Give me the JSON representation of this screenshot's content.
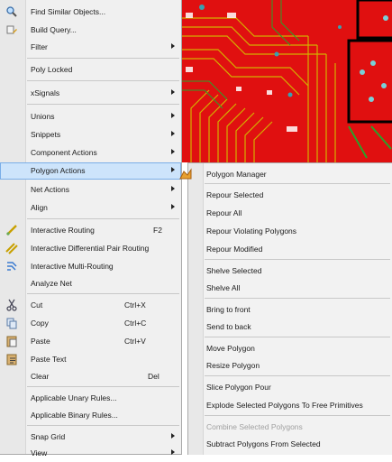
{
  "main_menu": {
    "items": [
      {
        "label": "Find Similar Objects...",
        "icon": "find-similar-icon"
      },
      {
        "label": "Build Query...",
        "icon": "build-query-icon"
      },
      {
        "label": "Filter"
      },
      {
        "label": "Poly Locked"
      },
      {
        "label": "xSignals"
      },
      {
        "label": "Unions"
      },
      {
        "label": "Snippets"
      },
      {
        "label": "Component Actions"
      },
      {
        "label": "Polygon Actions"
      },
      {
        "label": "Net Actions"
      },
      {
        "label": "Align"
      },
      {
        "label": "Interactive Routing",
        "shortcut": "F2",
        "icon": "interactive-routing-icon"
      },
      {
        "label": "Interactive Differential Pair Routing",
        "icon": "diff-pair-routing-icon"
      },
      {
        "label": "Interactive Multi-Routing",
        "icon": "multi-routing-icon"
      },
      {
        "label": "Analyze Net"
      },
      {
        "label": "Cut",
        "shortcut": "Ctrl+X",
        "icon": "cut-icon"
      },
      {
        "label": "Copy",
        "shortcut": "Ctrl+C",
        "icon": "copy-icon"
      },
      {
        "label": "Paste",
        "shortcut": "Ctrl+V",
        "icon": "paste-icon"
      },
      {
        "label": "Paste Text",
        "icon": "paste-text-icon"
      },
      {
        "label": "Clear",
        "shortcut": "Del"
      },
      {
        "label": "Applicable Unary Rules..."
      },
      {
        "label": "Applicable Binary Rules..."
      },
      {
        "label": "Snap Grid"
      },
      {
        "label": "View"
      }
    ]
  },
  "sub_menu": {
    "items": [
      {
        "label": "Polygon Manager",
        "icon": "polygon-manager-icon"
      },
      {
        "label": "Repour Selected"
      },
      {
        "label": "Repour All"
      },
      {
        "label": "Repour Violating Polygons"
      },
      {
        "label": "Repour Modified"
      },
      {
        "label": "Shelve Selected"
      },
      {
        "label": "Shelve All"
      },
      {
        "label": "Bring to front"
      },
      {
        "label": "Send to back"
      },
      {
        "label": "Move Polygon"
      },
      {
        "label": "Resize Polygon"
      },
      {
        "label": "Slice Polygon Pour"
      },
      {
        "label": "Explode Selected Polygons To Free Primitives"
      },
      {
        "label": "Combine Selected Polygons"
      },
      {
        "label": "Subtract Polygons From Selected"
      }
    ]
  },
  "colors": {
    "pcb_background": "#e01010",
    "pcb_trace": "#d4b000",
    "highlight": "#cde4fb",
    "disabled_text": "#a0a0a0"
  }
}
